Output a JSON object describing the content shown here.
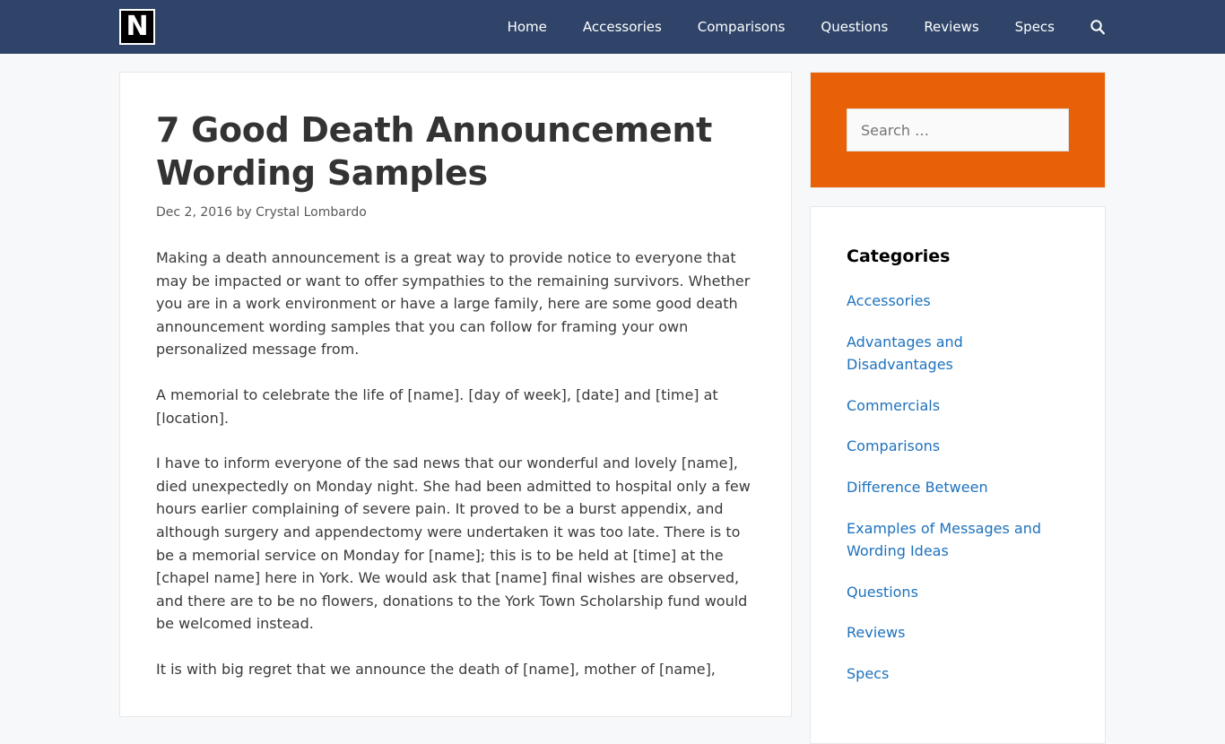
{
  "header": {
    "logo_letter": "N",
    "nav": [
      {
        "label": "Home"
      },
      {
        "label": "Accessories"
      },
      {
        "label": "Comparisons"
      },
      {
        "label": "Questions"
      },
      {
        "label": "Reviews"
      },
      {
        "label": "Specs"
      }
    ],
    "search_icon": "search-icon"
  },
  "article": {
    "title": "7 Good Death Announcement Wording Samples",
    "date": "Dec 2, 2016",
    "by": "by",
    "author": "Crystal Lombardo",
    "paragraphs": [
      "Making a death announcement is a great way to provide notice to everyone that may be impacted or want to offer sympathies to the remaining survivors. Whether you are in a work environment or have a large family, here are some good death announcement wording samples that you can follow for framing your own personalized message from.",
      "A memorial to celebrate the life of [name]. [day of week], [date] and [time] at [location].",
      "I have to inform everyone of the sad news that our wonderful and lovely [name], died unexpectedly on Monday night. She had been admitted to hospital only a few hours earlier complaining of severe pain. It proved to be a burst appendix, and although surgery and appendectomy were undertaken it was too late. There is to be a memorial service on Monday for [name]; this is to be held at [time] at the [chapel name] here in York. We would ask that [name] final wishes are observed, and there are to be no flowers, donations to the York Town Scholarship fund would be welcomed instead.",
      "It is with big regret that we announce the death of [name], mother of [name],"
    ]
  },
  "sidebar": {
    "search_placeholder": "Search …",
    "categories_title": "Categories",
    "categories": [
      {
        "label": "Accessories"
      },
      {
        "label": "Advantages and Disadvantages"
      },
      {
        "label": "Commercials"
      },
      {
        "label": "Comparisons"
      },
      {
        "label": "Difference Between"
      },
      {
        "label": "Examples of Messages and Wording Ideas"
      },
      {
        "label": "Questions"
      },
      {
        "label": "Reviews"
      },
      {
        "label": "Specs"
      }
    ]
  },
  "colors": {
    "header_bg": "#2f4468",
    "search_widget_bg": "#e96106",
    "link": "#1e72bd"
  }
}
